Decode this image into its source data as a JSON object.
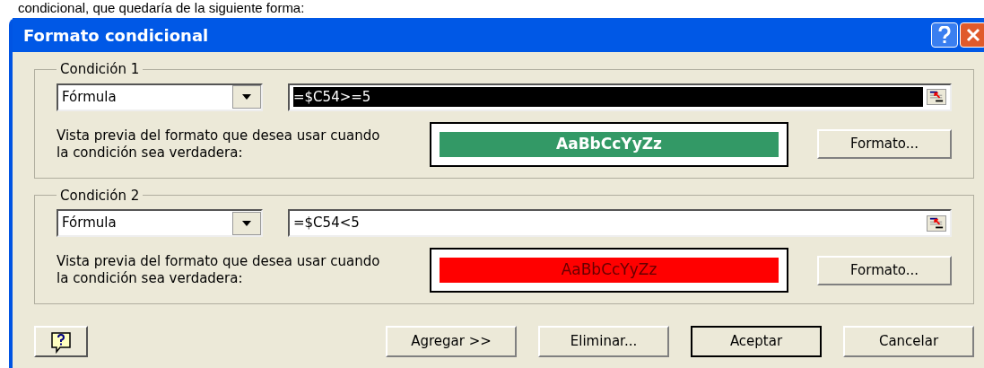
{
  "caption": "condicional, que quedaría de la siguiente forma:",
  "window": {
    "title": "Formato condicional"
  },
  "conditions": [
    {
      "label": "Condición 1",
      "type": "Fórmula",
      "formula": "=$C54>=5",
      "selected": true,
      "preview_label": "Vista previa del formato que desea usar cuando la condición sea verdadera:",
      "preview": {
        "text": "AaBbCcYyZz",
        "color": "#339966",
        "bold": true
      },
      "format_button": "Formato..."
    },
    {
      "label": "Condición 2",
      "type": "Fórmula",
      "formula": "=$C54<5",
      "selected": false,
      "preview_label": "Vista previa del formato que desea usar cuando la condición sea verdadera:",
      "preview": {
        "text": "AaBbCcYyZz",
        "color": "#ff0000",
        "bold": false
      },
      "format_button": "Formato..."
    }
  ],
  "buttons": [
    {
      "label": "Agregar >>",
      "default": false
    },
    {
      "label": "Eliminar...",
      "default": false
    },
    {
      "label": "Aceptar",
      "default": true
    },
    {
      "label": "Cancelar",
      "default": false
    }
  ]
}
